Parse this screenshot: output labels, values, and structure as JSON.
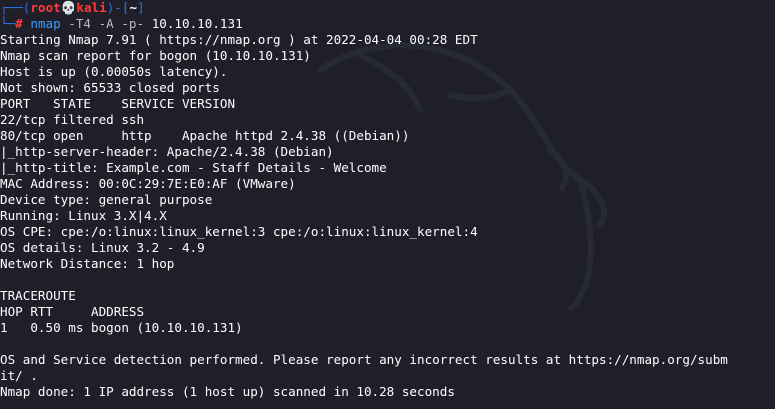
{
  "prompt": {
    "frame_top": "┌──(",
    "user": "root",
    "skull": "💀",
    "host": "kali",
    "frame_mid": ")-[",
    "path": "~",
    "frame_end": "]",
    "frame_bottom": "└─",
    "hash": "# "
  },
  "command": {
    "program": "nmap",
    "flags": " -T4 -A -p- ",
    "target": "10.10.10.131"
  },
  "output_lines": [
    "Starting Nmap 7.91 ( https://nmap.org ) at 2022-04-04 00:28 EDT",
    "Nmap scan report for bogon (10.10.10.131)",
    "Host is up (0.00050s latency).",
    "Not shown: 65533 closed ports",
    "PORT   STATE    SERVICE VERSION",
    "22/tcp filtered ssh",
    "80/tcp open     http    Apache httpd 2.4.38 ((Debian))",
    "|_http-server-header: Apache/2.4.38 (Debian)",
    "|_http-title: Example.com - Staff Details - Welcome",
    "MAC Address: 00:0C:29:7E:E0:AF (VMware)",
    "Device type: general purpose",
    "Running: Linux 3.X|4.X",
    "OS CPE: cpe:/o:linux:linux_kernel:3 cpe:/o:linux:linux_kernel:4",
    "OS details: Linux 3.2 - 4.9",
    "Network Distance: 1 hop",
    "",
    "TRACEROUTE",
    "HOP RTT     ADDRESS",
    "1   0.50 ms bogon (10.10.10.131)",
    "",
    "OS and Service detection performed. Please report any incorrect results at https://nmap.org/subm",
    "it/ .",
    "Nmap done: 1 IP address (1 host up) scanned in 10.28 seconds"
  ],
  "colors": {
    "background": "#1e1f29",
    "prompt_frame": "#2f6fe0",
    "prompt_user": "#ff3b3b",
    "command": "#3aa0ff",
    "text": "#ffffff"
  }
}
